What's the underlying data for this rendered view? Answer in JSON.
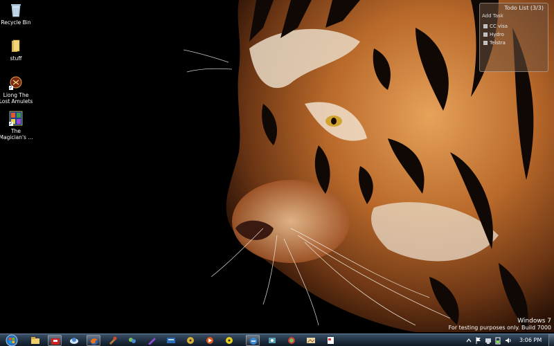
{
  "desktop": {
    "icons": [
      {
        "label": "Recycle Bin",
        "icon": "recycle-bin-icon"
      },
      {
        "label": "stuff",
        "icon": "folder-icon"
      },
      {
        "label": "Liong The Lost Amulets",
        "icon": "liong-game-icon"
      },
      {
        "label": "The Magician's ...",
        "icon": "magician-game-icon"
      }
    ]
  },
  "todo": {
    "title": "Todo List (3/3)",
    "add_label": "Add Task",
    "items": [
      "CC visa",
      "Hydro",
      "Telstra"
    ]
  },
  "watermark": {
    "line1": "Windows 7",
    "line2": "For testing purposes only. Build 7000"
  },
  "taskbar": {
    "start": "start-orb-icon",
    "buttons": [
      "explorer-icon",
      "toolbox-icon",
      "cloud-app-icon",
      "firefox-icon",
      "tools-icon",
      "chat-icon",
      "pen-icon",
      "fm-app-icon",
      "disk-icon",
      "media-icon",
      "radiation-icon",
      "ie-icon",
      "paint-icon",
      "globe-app-icon",
      "image-viewer-icon",
      "document-icon"
    ],
    "tray": [
      "show-hidden-icons-icon",
      "action-center-flag-icon",
      "network-icon",
      "battery-icon",
      "volume-icon"
    ],
    "clock": "3:06 PM"
  },
  "colors": {
    "taskbar_top": "#3a4f66",
    "taskbar_bottom": "#111a26",
    "tiger_orange": "#c97a2e"
  }
}
